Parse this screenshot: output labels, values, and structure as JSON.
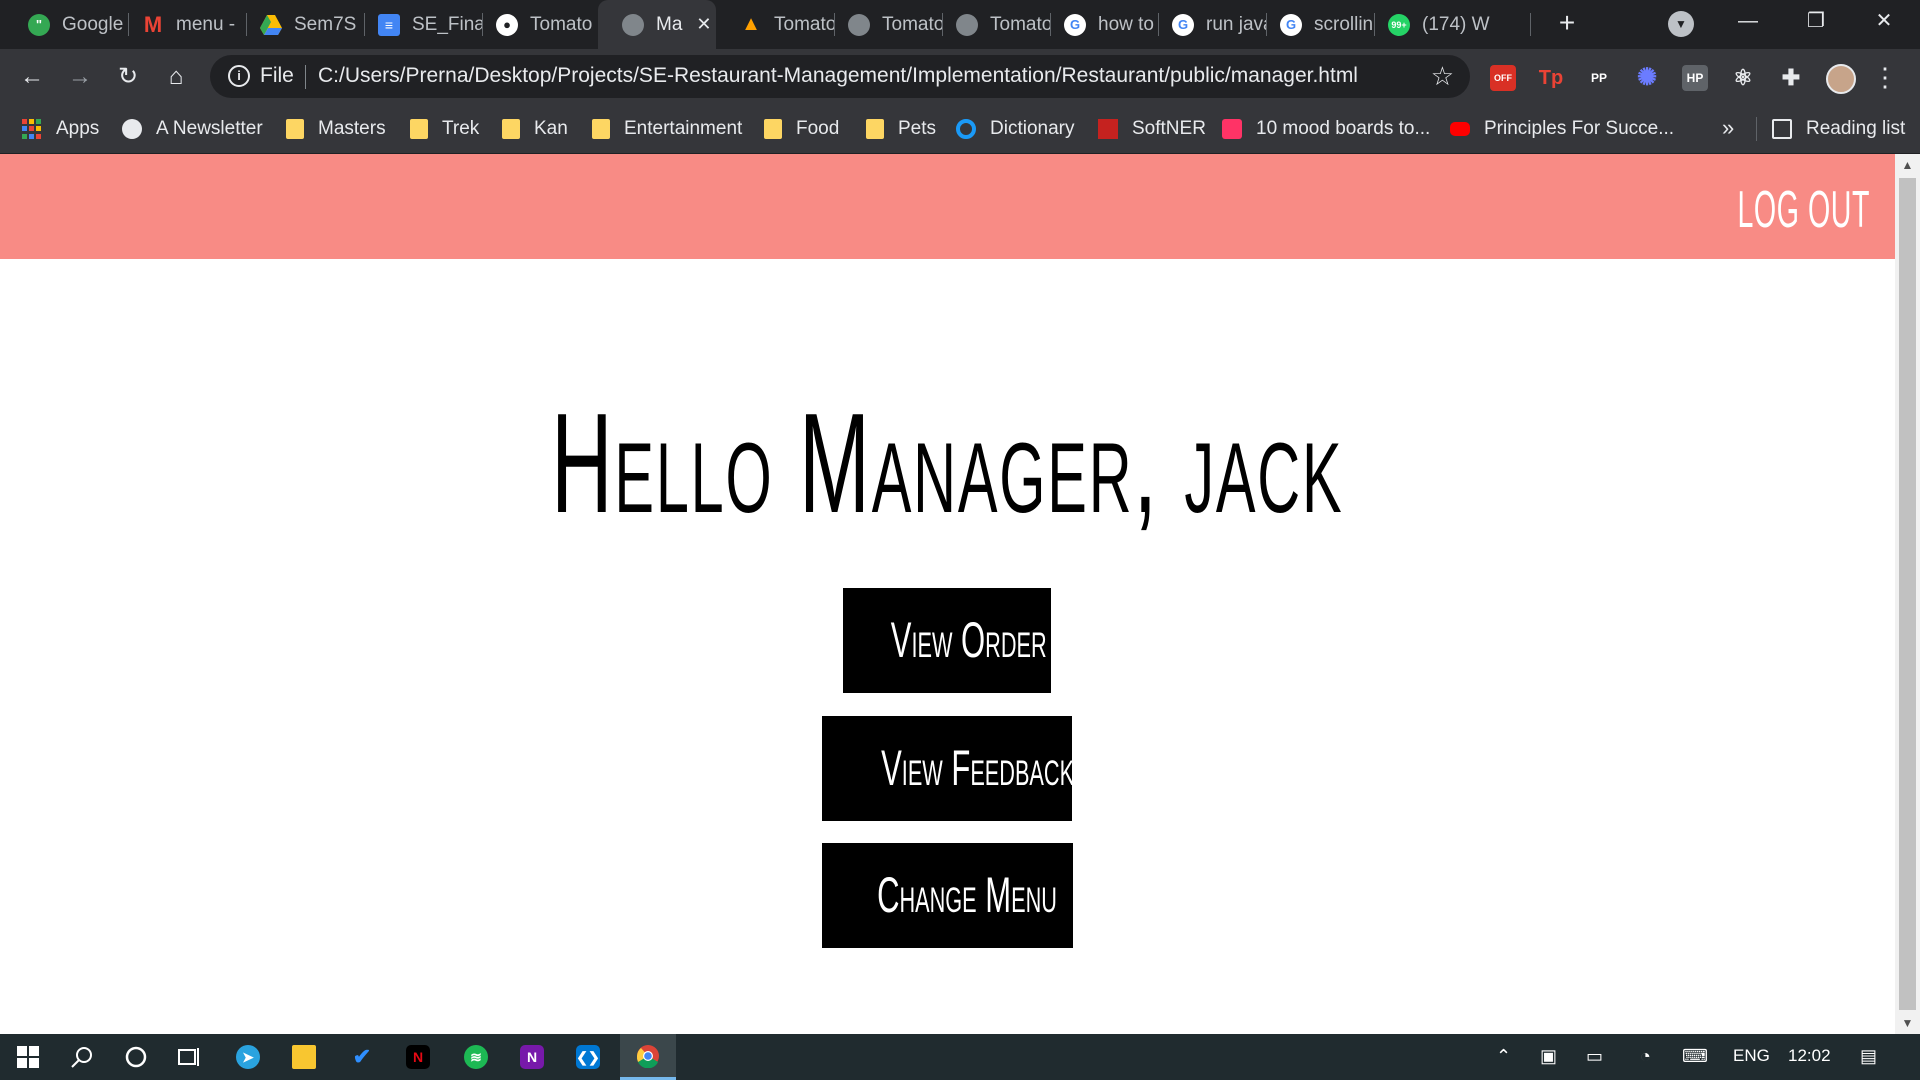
{
  "browser": {
    "tabs": [
      {
        "title": "Google",
        "icon": "google-chat-icon",
        "color": "#34a853"
      },
      {
        "title": "menu -",
        "icon": "gmail-icon",
        "color": "#ea4335"
      },
      {
        "title": "Sem7S",
        "icon": "google-drive-icon",
        "color": "#fbbc04"
      },
      {
        "title": "SE_Fina",
        "icon": "google-docs-icon",
        "color": "#4285f4"
      },
      {
        "title": "Tomato",
        "icon": "github-icon",
        "color": "#ffffff"
      },
      {
        "title": "Ma",
        "icon": "globe-icon",
        "color": "#9aa0a6"
      },
      {
        "title": "Tomato",
        "icon": "firebase-icon",
        "color": "#ffa000"
      },
      {
        "title": "Tomato",
        "icon": "globe-icon",
        "color": "#9aa0a6"
      },
      {
        "title": "Tomato",
        "icon": "globe-icon",
        "color": "#9aa0a6"
      },
      {
        "title": "how to",
        "icon": "google-icon",
        "color": "#ffffff"
      },
      {
        "title": "run java",
        "icon": "google-icon",
        "color": "#ffffff"
      },
      {
        "title": "scrollin",
        "icon": "google-icon",
        "color": "#ffffff"
      },
      {
        "title": "(174) W",
        "icon": "whatsapp-icon",
        "color": "#25d366",
        "badge": "99+"
      }
    ],
    "active_tab_close": "✕",
    "new_tab": "+",
    "omnibox": {
      "scheme_label": "File",
      "url": "C:/Users/Prerna/Desktop/Projects/SE-Restaurant-Management/Implementation/Restaurant/public/manager.html"
    },
    "extensions": [
      {
        "label": "OFF",
        "color": "#d93025",
        "icon": "adblock-off-icon"
      },
      {
        "label": "Tp",
        "color": "#d93025",
        "icon": "tp-extension-icon"
      },
      {
        "label": "PP",
        "color": "#5f6368",
        "icon": "pp-extension-icon"
      },
      {
        "label": "✺",
        "color": "#3b5bfd",
        "icon": "snowflake-extension-icon"
      },
      {
        "label": "HP",
        "color": "#5f6368",
        "icon": "hp-extension-icon"
      },
      {
        "label": "⚛",
        "color": "#35363a",
        "icon": "react-devtools-icon"
      },
      {
        "label": "✚",
        "color": "#35363a",
        "icon": "extensions-puzzle-icon"
      }
    ],
    "bookmarks": [
      {
        "label": "Apps",
        "icon": "apps-grid-icon"
      },
      {
        "label": "A Newsletter",
        "icon": "globe-icon"
      },
      {
        "label": "Masters",
        "icon": "folder-icon"
      },
      {
        "label": "Trek",
        "icon": "folder-icon"
      },
      {
        "label": "Kan",
        "icon": "folder-icon"
      },
      {
        "label": "Entertainment",
        "icon": "folder-icon"
      },
      {
        "label": "Food",
        "icon": "folder-icon"
      },
      {
        "label": "Pets",
        "icon": "folder-icon"
      },
      {
        "label": "Dictionary",
        "icon": "dictionary-icon"
      },
      {
        "label": "SoftNER",
        "icon": "softner-icon"
      },
      {
        "label": "10 mood boards to...",
        "icon": "invision-icon"
      },
      {
        "label": "Principles For Succe...",
        "icon": "youtube-icon"
      }
    ],
    "bookmarks_more": "»",
    "reading_list": "Reading list"
  },
  "page": {
    "header": {
      "logout_label": "LOG OUT",
      "color": "#f88b85"
    },
    "greeting": "Hello Manager, jack",
    "buttons": [
      {
        "label": "View Order"
      },
      {
        "label": "View Feedback"
      },
      {
        "label": "Change Menu"
      }
    ]
  },
  "taskbar": {
    "apps": [
      {
        "icon": "windows-start-icon"
      },
      {
        "icon": "search-icon"
      },
      {
        "icon": "cortana-icon"
      },
      {
        "icon": "task-view-icon"
      },
      {
        "icon": "telegram-icon"
      },
      {
        "icon": "file-explorer-icon"
      },
      {
        "icon": "todo-icon"
      },
      {
        "icon": "netflix-icon"
      },
      {
        "icon": "spotify-icon"
      },
      {
        "icon": "onenote-icon"
      },
      {
        "icon": "vscode-icon"
      },
      {
        "icon": "chrome-icon"
      }
    ],
    "language": "ENG",
    "time": "12:02"
  }
}
